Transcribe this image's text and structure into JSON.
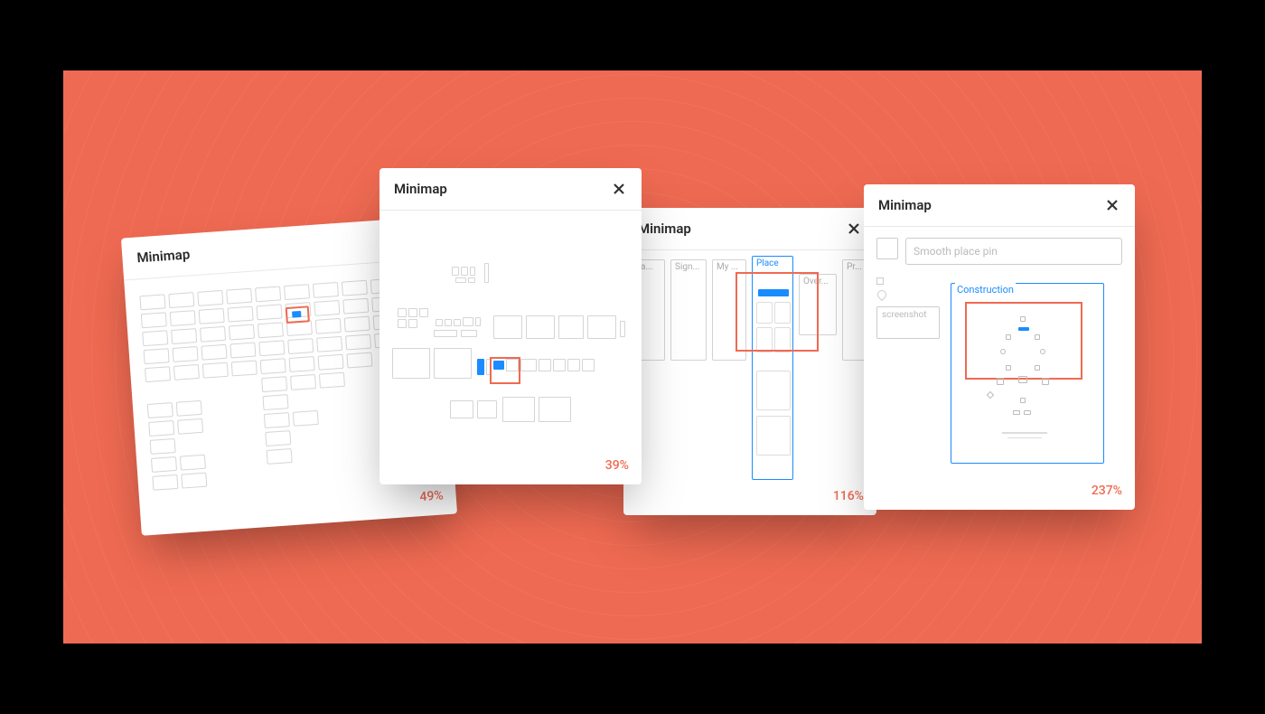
{
  "panels": {
    "p1": {
      "title": "Minimap",
      "zoom": "49%"
    },
    "p2": {
      "title": "Minimap",
      "zoom": "39%"
    },
    "p3": {
      "title": "Minimap",
      "zoom": "116%",
      "columns": {
        "a": "a...",
        "sign": "Sign...",
        "my": "My ...",
        "place": "Place",
        "over": "Over...",
        "pr": "Pr..."
      }
    },
    "p4": {
      "title": "Minimap",
      "zoom": "237%",
      "smooth_label": "Smooth place pin",
      "screenshot_label": "screenshot",
      "construction_label": "Construction"
    }
  },
  "colors": {
    "accent": "#ef6a52",
    "selection": "#1a8cff"
  }
}
